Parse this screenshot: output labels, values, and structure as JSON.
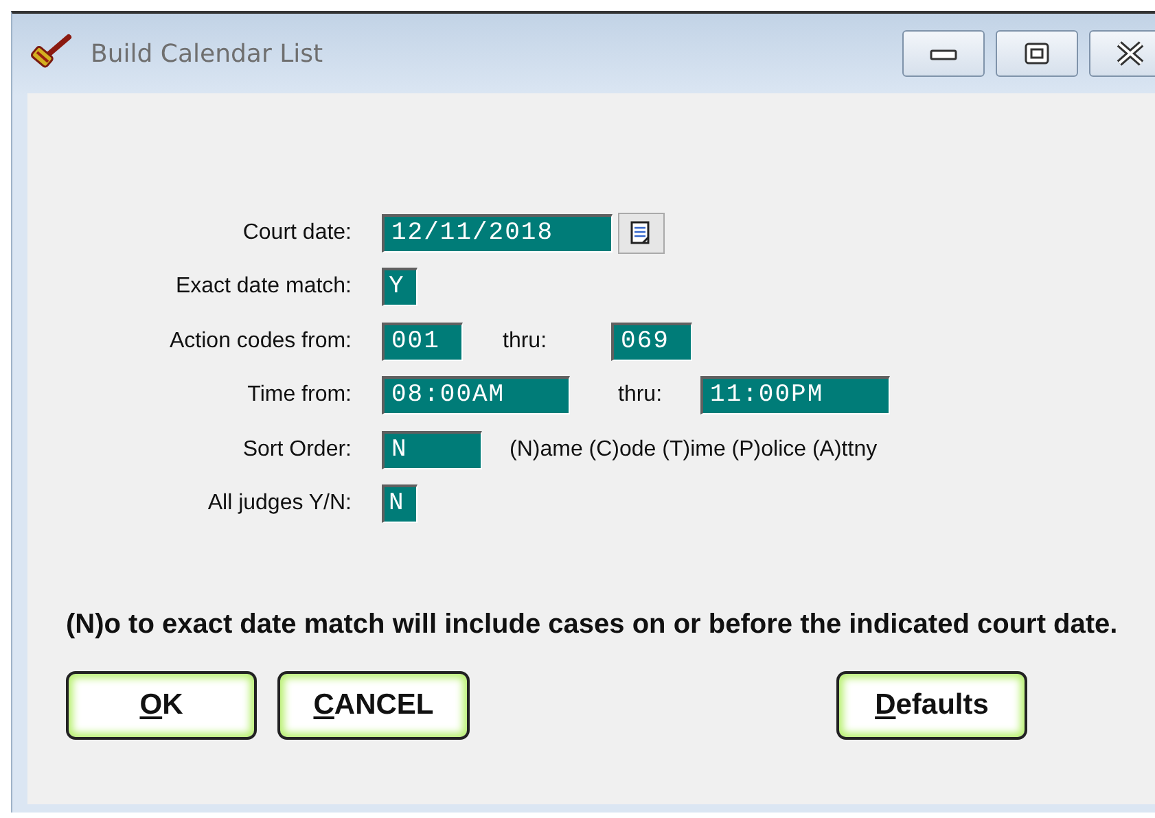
{
  "window": {
    "title": "Build Calendar List"
  },
  "fields": [
    {
      "kind": "date",
      "label": "Court date:",
      "value": "12/11/2018"
    },
    {
      "kind": "text",
      "label": "Exact date match:",
      "value": "Y"
    },
    {
      "kind": "range",
      "label": "Action codes from:",
      "value": "001",
      "thru_label": "thru:",
      "thru_value": "069"
    },
    {
      "kind": "range",
      "label": "Time from:",
      "value": "08:00AM",
      "thru_label": "thru:",
      "thru_value": "11:00PM"
    },
    {
      "kind": "hint",
      "label": "Sort Order:",
      "value": "N",
      "hint": "(N)ame (C)ode (T)ime (P)olice (A)ttny"
    },
    {
      "kind": "text",
      "label": "All judges Y/N:",
      "value": "N"
    }
  ],
  "note": "(N)o to exact date match will include cases on or before the indicated court date.",
  "buttons": [
    {
      "mnemonic": "O",
      "rest": "K"
    },
    {
      "mnemonic": "C",
      "rest": "ANCEL"
    },
    {
      "mnemonic": "D",
      "rest": "efaults"
    }
  ]
}
